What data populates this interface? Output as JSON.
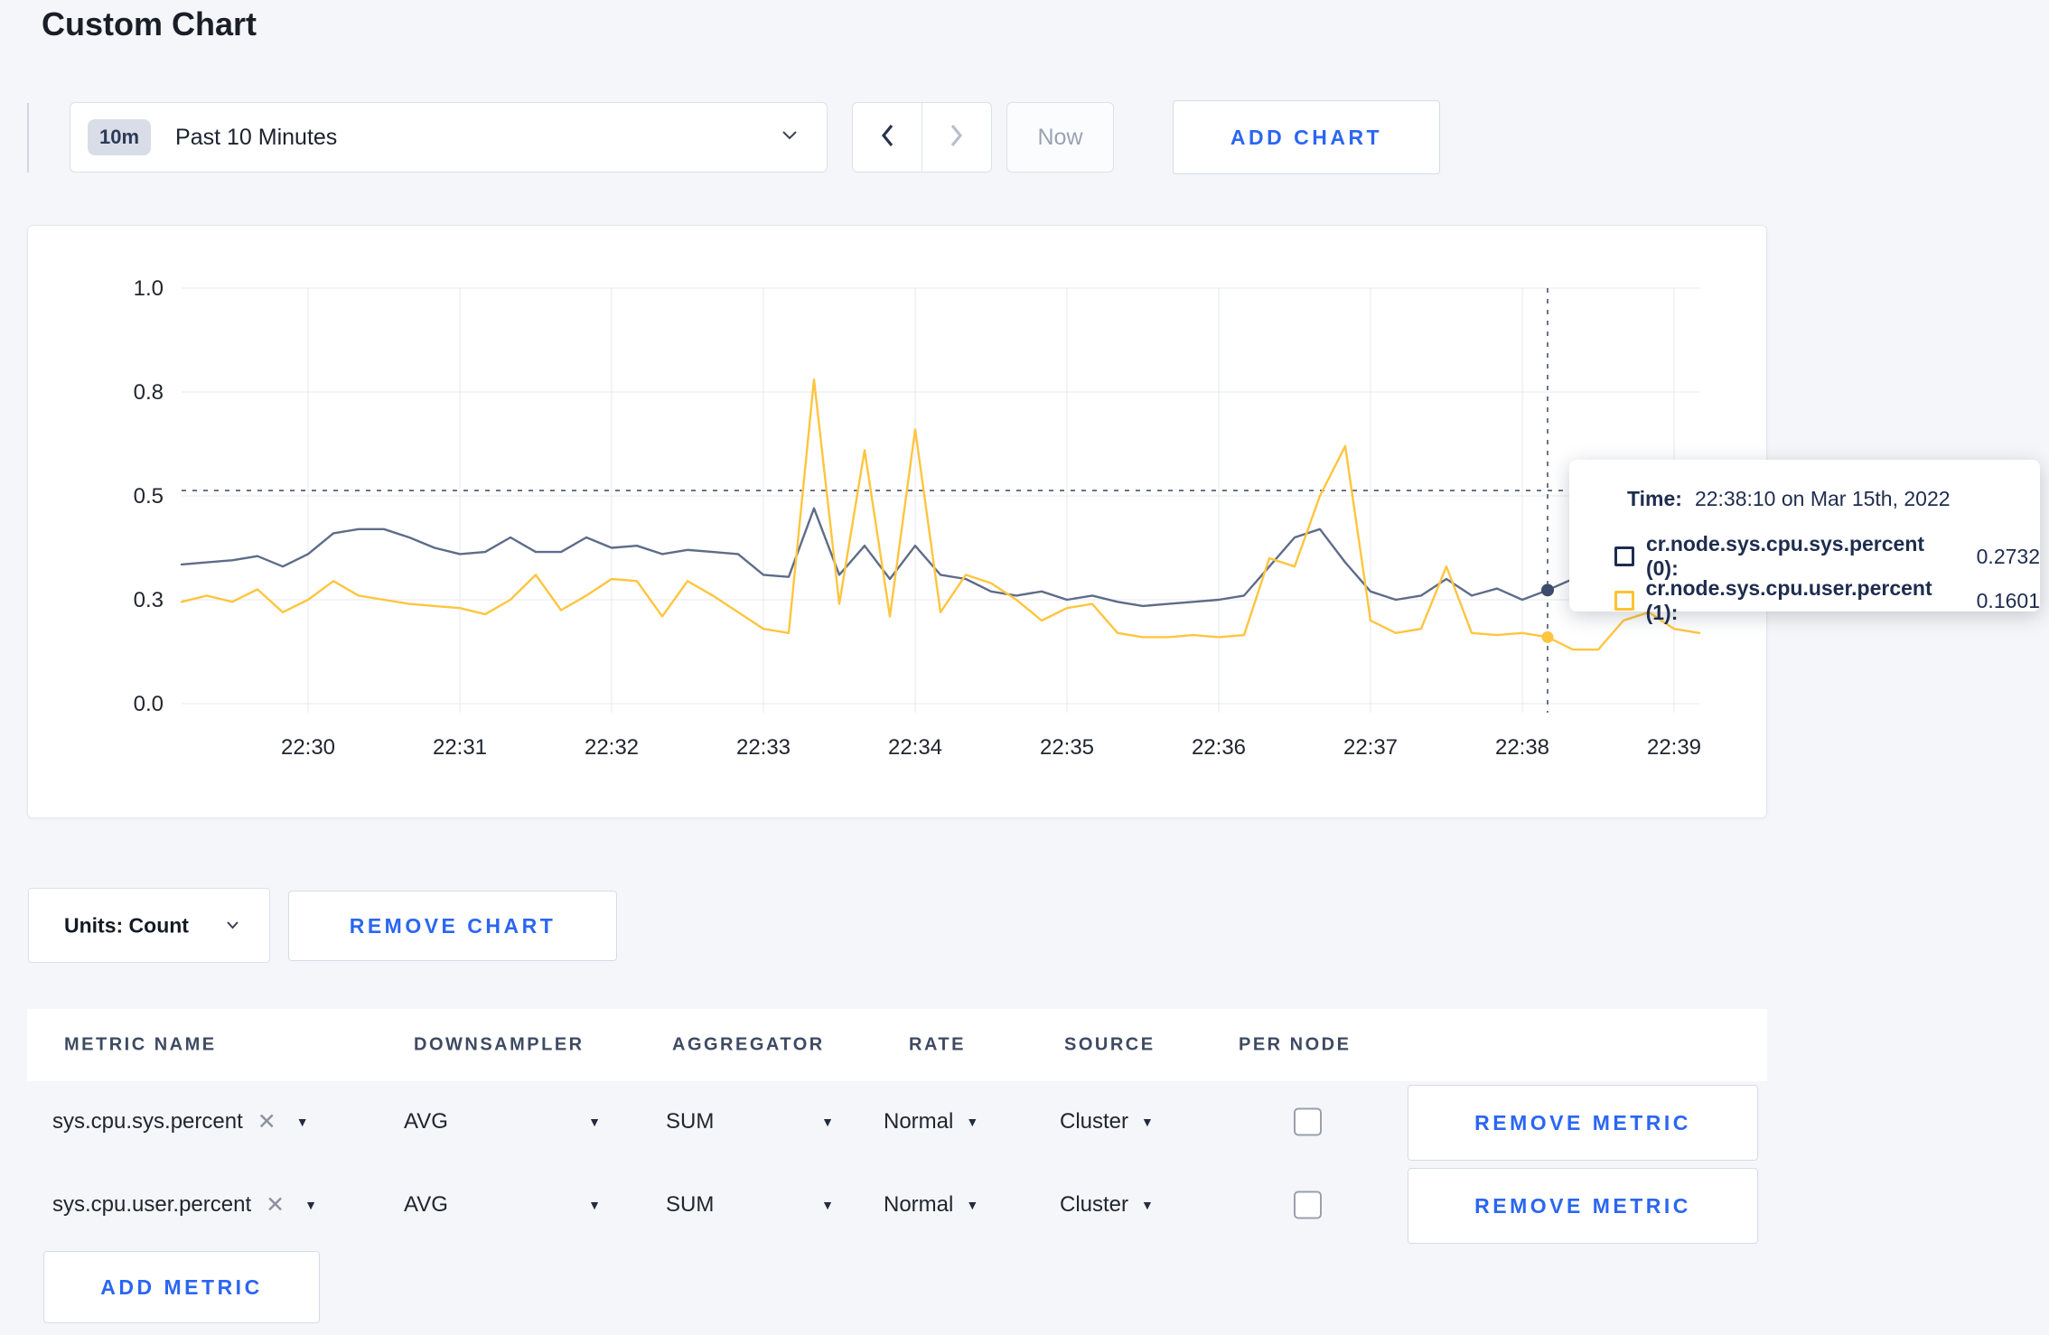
{
  "page": {
    "title": "Custom Chart"
  },
  "colors": {
    "accent_blue": "#2b66f2",
    "page_bg": "#f5f6f9",
    "grid": "#e7e8ec",
    "crosshair": "#47536e"
  },
  "icons": {
    "caret": "▼",
    "close": "✕"
  },
  "toolbar": {
    "range_badge": "10m",
    "range_label": "Past 10 Minutes",
    "now_label": "Now",
    "add_chart_label": "ADD CHART"
  },
  "chart_data": {
    "type": "line",
    "title": "",
    "xlabel": "",
    "ylabel": "",
    "ylim": [
      0,
      1
    ],
    "grid": true,
    "legend_position": "none",
    "x_start_label": "22:29:10",
    "x_step_seconds": 10,
    "x_domain_seconds": 600,
    "x_ticks": [
      {
        "label": "22:30",
        "sec": 50
      },
      {
        "label": "22:31",
        "sec": 110
      },
      {
        "label": "22:32",
        "sec": 170
      },
      {
        "label": "22:33",
        "sec": 230
      },
      {
        "label": "22:34",
        "sec": 290
      },
      {
        "label": "22:35",
        "sec": 350
      },
      {
        "label": "22:36",
        "sec": 410
      },
      {
        "label": "22:37",
        "sec": 470
      },
      {
        "label": "22:38",
        "sec": 530
      },
      {
        "label": "22:39",
        "sec": 590
      }
    ],
    "y_ticks": [
      {
        "label": "0.0",
        "v": 0
      },
      {
        "label": "0.3",
        "v": 0.25
      },
      {
        "label": "0.5",
        "v": 0.5
      },
      {
        "label": "0.8",
        "v": 0.75
      },
      {
        "label": "1.0",
        "v": 1.0
      }
    ],
    "series": [
      {
        "name": "cr.node.sys.cpu.sys.percent (0)",
        "color": "#5e6c89",
        "dot_color": "#3c4c6d",
        "values": [
          0.335,
          0.34,
          0.345,
          0.355,
          0.33,
          0.36,
          0.41,
          0.42,
          0.42,
          0.4,
          0.375,
          0.36,
          0.365,
          0.4,
          0.365,
          0.365,
          0.4,
          0.375,
          0.38,
          0.36,
          0.37,
          0.365,
          0.36,
          0.31,
          0.305,
          0.47,
          0.31,
          0.38,
          0.3,
          0.38,
          0.31,
          0.3,
          0.27,
          0.26,
          0.27,
          0.25,
          0.26,
          0.245,
          0.235,
          0.24,
          0.245,
          0.25,
          0.26,
          0.33,
          0.4,
          0.42,
          0.34,
          0.27,
          0.25,
          0.26,
          0.3,
          0.26,
          0.277,
          0.25,
          0.2732,
          0.3,
          0.31,
          0.3,
          0.305,
          0.3,
          0.295
        ]
      },
      {
        "name": "cr.node.sys.cpu.user.percent (1)",
        "color": "#ffc53f",
        "dot_color": "#ffc53f",
        "values": [
          0.245,
          0.26,
          0.245,
          0.275,
          0.22,
          0.25,
          0.295,
          0.26,
          0.25,
          0.24,
          0.235,
          0.23,
          0.215,
          0.25,
          0.31,
          0.225,
          0.26,
          0.3,
          0.295,
          0.21,
          0.295,
          0.26,
          0.22,
          0.18,
          0.17,
          0.78,
          0.24,
          0.61,
          0.21,
          0.66,
          0.22,
          0.31,
          0.29,
          0.25,
          0.2,
          0.23,
          0.24,
          0.17,
          0.16,
          0.16,
          0.165,
          0.16,
          0.165,
          0.35,
          0.33,
          0.5,
          0.62,
          0.2,
          0.17,
          0.18,
          0.33,
          0.17,
          0.165,
          0.17,
          0.1601,
          0.13,
          0.13,
          0.2,
          0.22,
          0.18,
          0.17
        ]
      }
    ],
    "crosshair": {
      "sec": 540,
      "hline_value": 0.513,
      "points": [
        {
          "series": 0,
          "value": 0.2732
        },
        {
          "series": 1,
          "value": 0.1601
        }
      ]
    }
  },
  "tooltip": {
    "time_label": "Time:",
    "time_value": "22:38:10 on Mar 15th, 2022",
    "rows": [
      {
        "label": "cr.node.sys.cpu.sys.percent (0):",
        "value": "0.2732",
        "square_color": "#1e2c4e"
      },
      {
        "label": "cr.node.sys.cpu.user.percent (1):",
        "value": "0.1601",
        "square_color": "#ffc32e"
      }
    ]
  },
  "chart_controls": {
    "units_label": "Units: Count",
    "remove_chart_label": "REMOVE CHART"
  },
  "metrics_table": {
    "headers": [
      "METRIC NAME",
      "DOWNSAMPLER",
      "AGGREGATOR",
      "RATE",
      "SOURCE",
      "PER NODE"
    ],
    "rows": [
      {
        "metric": "sys.cpu.sys.percent",
        "downsampler": "AVG",
        "aggregator": "SUM",
        "rate": "Normal",
        "source": "Cluster",
        "per_node_checked": false,
        "remove_label": "REMOVE METRIC"
      },
      {
        "metric": "sys.cpu.user.percent",
        "downsampler": "AVG",
        "aggregator": "SUM",
        "rate": "Normal",
        "source": "Cluster",
        "per_node_checked": false,
        "remove_label": "REMOVE METRIC"
      }
    ],
    "add_metric_label": "ADD METRIC"
  }
}
